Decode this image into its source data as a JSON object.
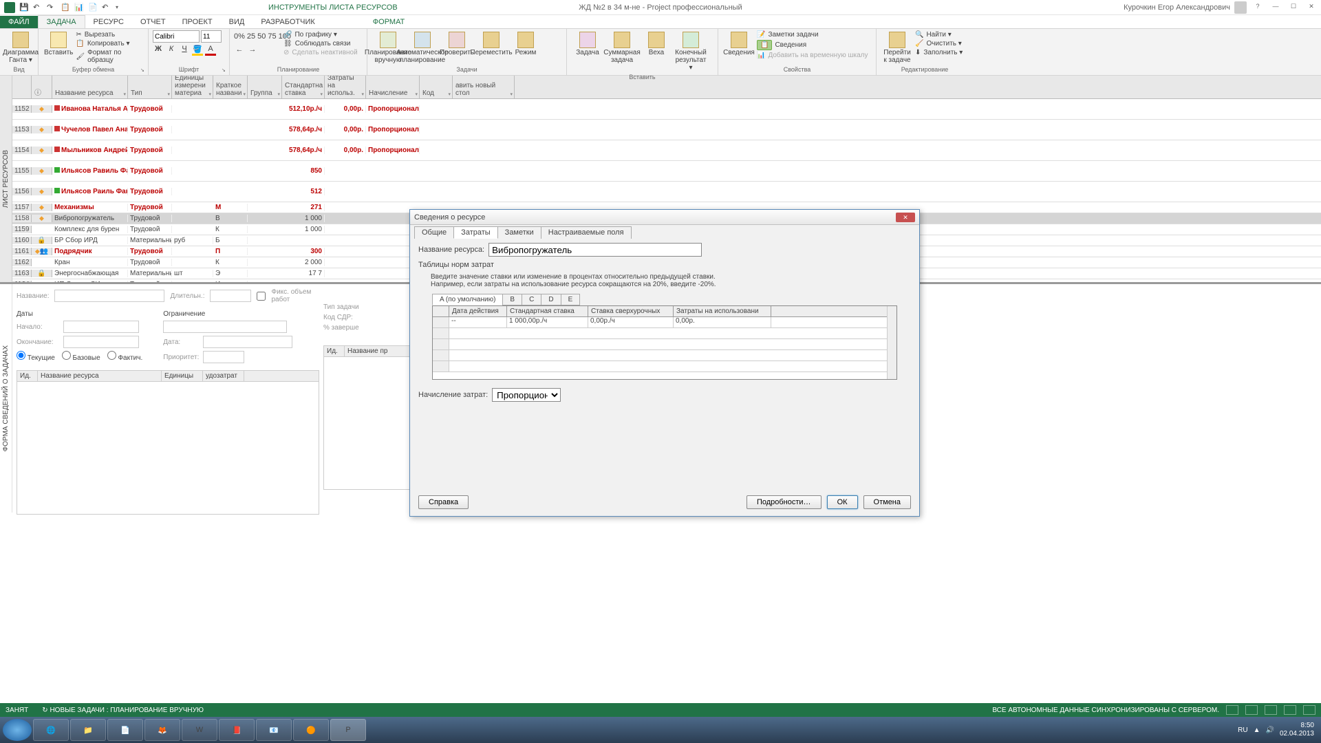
{
  "titlebar": {
    "tools_title": "ИНСТРУМЕНТЫ ЛИСТА РЕСУРСОВ",
    "doc_title": "ЖД №2 в 34 м-не - Project профессиональный",
    "user": "Курочкин Егор Александрович"
  },
  "tabs": {
    "file": "ФАЙЛ",
    "task": "ЗАДАЧА",
    "resource": "РЕСУРС",
    "report": "ОТЧЕТ",
    "project": "ПРОЕКТ",
    "view": "ВИД",
    "developer": "РАЗРАБОТЧИК",
    "format": "ФОРМАТ"
  },
  "ribbon": {
    "gantt": "Диаграмма Ганта ▾",
    "group_view": "Вид",
    "paste": "Вставить",
    "cut": "Вырезать",
    "copy": "Копировать ▾",
    "format_painter": "Формат по образцу",
    "group_clipboard": "Буфер обмена",
    "font_name": "Calibri",
    "font_size": "11",
    "group_font": "Шрифт",
    "group_schedule": "Планирование",
    "by_schedule": "По графику ▾",
    "respect_links": "Соблюдать связи",
    "make_inactive": "Сделать неактивной",
    "manual": "Планирование вручную",
    "auto": "Автоматическое планирование",
    "inspect": "Проверить",
    "move": "Переместить",
    "mode": "Режим",
    "group_tasks": "Задачи",
    "task_btn": "Задача",
    "summary": "Суммарная задача",
    "milestone": "Веха",
    "deliverable": "Конечный результат ▾",
    "group_insert": "Вставить",
    "info": "Сведения",
    "notes": "Заметки задачи",
    "details": "Сведения",
    "timeline": "Добавить на временную шкалу",
    "group_props": "Свойства",
    "scroll_to": "Перейти к задаче",
    "find": "Найти ▾",
    "clear": "Очистить ▾",
    "fill": "Заполнить ▾",
    "group_edit": "Редактирование"
  },
  "side_label_top": "ЛИСТ РЕСУРСОВ",
  "side_label_bottom": "ФОРМА СВЕДЕНИЙ О ЗАДАЧАХ",
  "columns": {
    "name": "Название ресурса",
    "type": "Тип",
    "unit": "Единицы измерени материа",
    "short": "Краткое названи",
    "group": "Группа",
    "rate": "Стандартна ставка",
    "cost": "Затраты на использ.",
    "accr": "Начисление",
    "code": "Код",
    "new": "авить новый стол"
  },
  "rows": [
    {
      "n": "1152",
      "ind": "warn",
      "sq": "red",
      "name": "Иванова Наталья Александровна",
      "type": "Трудовой",
      "rate": "512,10р./ч",
      "cost": "0,00р.",
      "accr": "Пропорционал",
      "red": true,
      "dbl": true
    },
    {
      "n": "1153",
      "ind": "warn",
      "sq": "red",
      "name": "Чучелов Павел Анатольевич",
      "type": "Трудовой",
      "rate": "578,64р./ч",
      "cost": "0,00р.",
      "accr": "Пропорционал",
      "red": true,
      "dbl": true
    },
    {
      "n": "1154",
      "ind": "warn",
      "sq": "red",
      "name": "Мыльников Андрей",
      "type": "Трудовой",
      "rate": "578,64р./ч",
      "cost": "0,00р.",
      "accr": "Пропорционал",
      "red": true,
      "dbl": true
    },
    {
      "n": "1155",
      "ind": "warn",
      "sq": "green",
      "name": "Ильясов Равиль Фанильевич",
      "type": "Трудовой",
      "rate": "850",
      "red": true,
      "dbl": true
    },
    {
      "n": "1156",
      "ind": "warn",
      "sq": "green",
      "name": "Ильясов Раиль Фанилевич",
      "type": "Трудовой",
      "rate": "512",
      "red": true,
      "dbl": true
    },
    {
      "n": "1157",
      "ind": "warn",
      "name": "Механизмы",
      "type": "Трудовой",
      "short": "М",
      "rate": "271",
      "red": true
    },
    {
      "n": "1158",
      "ind": "warn",
      "name": "Вибропогружатель",
      "type": "Трудовой",
      "short": "В",
      "rate": "1 000",
      "sel": true
    },
    {
      "n": "1159",
      "name": "Комплекс для бурен",
      "type": "Трудовой",
      "short": "К",
      "rate": "1 000"
    },
    {
      "n": "1160",
      "ind": "lock",
      "name": "БР Сбор ИРД",
      "type": "Материальны",
      "unit": "руб",
      "short": "Б"
    },
    {
      "n": "1161",
      "ind": "warn2",
      "name": "Подрядчик",
      "type": "Трудовой",
      "short": "П",
      "rate": "300",
      "red": true
    },
    {
      "n": "1162",
      "name": "Кран",
      "type": "Трудовой",
      "short": "К",
      "rate": "2 000"
    },
    {
      "n": "1163",
      "ind": "lock",
      "name": "Энергоснабжающая",
      "type": "Материальны",
      "unit": "шт",
      "short": "Э",
      "rate": "17 7"
    },
    {
      "n": "1164",
      "name": "ИП Савчук СИ",
      "type": "Трудовой",
      "short": "И"
    }
  ],
  "lower": {
    "name_lbl": "Название:",
    "duration_lbl": "Длительн.:",
    "fixed_lbl": "Фикс. объем работ",
    "dates_title": "Даты",
    "start_lbl": "Начало:",
    "end_lbl": "Окончание:",
    "constraint_title": "Ограничение",
    "date_lbl": "Дата:",
    "priority_lbl": "Приоритет:",
    "tasktype_lbl": "Тип задачи",
    "wbs_lbl": "Код СДР:",
    "pct_lbl": "% заверше",
    "radio_current": "Текущие",
    "radio_baseline": "Базовые",
    "radio_actual": "Фактич.",
    "tbl_id": "Ид.",
    "tbl_name": "Название ресурса",
    "tbl_units": "Единицы",
    "tbl_cost": "удозатрат",
    "tbl_name2": "Название пр"
  },
  "dialog": {
    "title": "Сведения о ресурсе",
    "tab_general": "Общие",
    "tab_costs": "Затраты",
    "tab_notes": "Заметки",
    "tab_custom": "Настраиваемые поля",
    "name_lbl": "Название ресурса:",
    "name_val": "Вибропогружатель",
    "tables_lbl": "Таблицы норм затрат",
    "hint1": "Введите значение ставки или изменение в процентах относительно предыдущей ставки.",
    "hint2": "Например, если затраты на использование ресурса сокращаются на 20%, введите -20%.",
    "rtab_a": "A (по умолчанию)",
    "rtab_b": "B",
    "rtab_c": "C",
    "rtab_d": "D",
    "rtab_e": "E",
    "col_date": "Дата действия",
    "col_std": "Стандартная ставка",
    "col_ovt": "Ставка сверхурочных",
    "col_per": "Затраты на использовани",
    "row_date": "--",
    "row_std": "1 000,00р./ч",
    "row_ovt": "0,00р./ч",
    "row_per": "0,00р.",
    "accrual_lbl": "Начисление затрат:",
    "accrual_val": "Пропорциона",
    "btn_help": "Справка",
    "btn_details": "Подробности…",
    "btn_ok": "ОК",
    "btn_cancel": "Отмена"
  },
  "statusbar": {
    "busy": "ЗАНЯТ",
    "new_tasks": "НОВЫЕ ЗАДАЧИ : ПЛАНИРОВАНИЕ ВРУЧНУЮ",
    "sync": "ВСЕ АВТОНОМНЫЕ ДАННЫЕ СИНХРОНИЗИРОВАНЫ С СЕРВЕРОМ."
  },
  "taskbar": {
    "lang": "RU",
    "time": "8:50",
    "date": "02.04.2013"
  }
}
